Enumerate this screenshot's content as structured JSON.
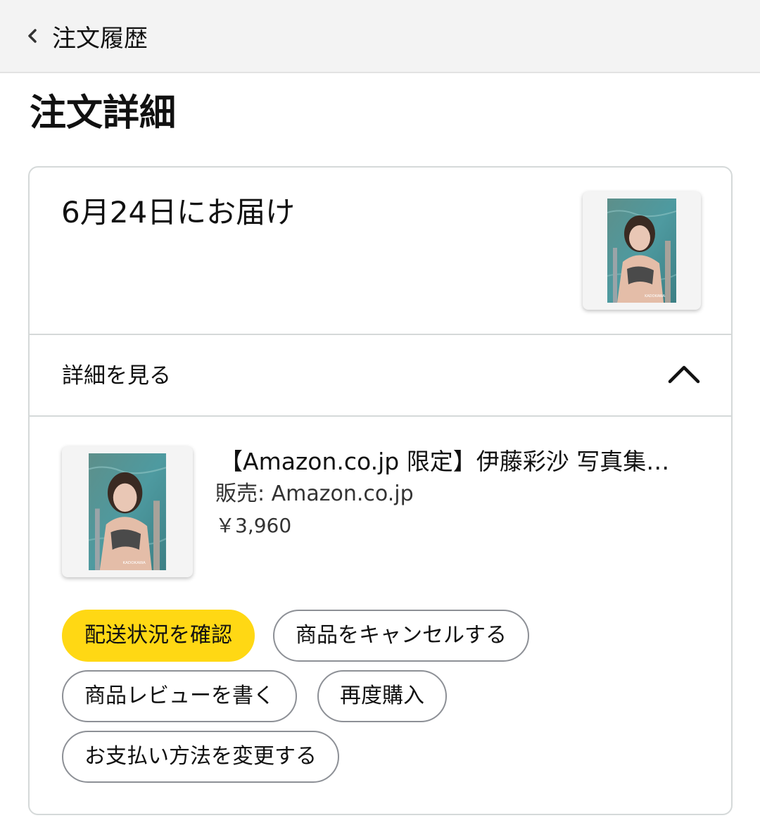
{
  "header": {
    "back_label": "注文履歴"
  },
  "page": {
    "title": "注文詳細"
  },
  "delivery": {
    "title": "6月24日にお届け"
  },
  "details": {
    "toggle_label": "詳細を見る"
  },
  "item": {
    "title": "【Amazon.co.jp 限定】伊藤彩沙 写真集…",
    "seller": "販売: Amazon.co.jp",
    "price": "￥3,960",
    "cover_text": "KADOKAWA"
  },
  "actions": {
    "track": "配送状況を確認",
    "cancel": "商品をキャンセルする",
    "review": "商品レビューを書く",
    "buy_again": "再度購入",
    "change_payment": "お支払い方法を変更する"
  },
  "colors": {
    "primary_button": "#ffd814",
    "border": "#d5d9d9",
    "header_bg": "#f3f3f3"
  }
}
